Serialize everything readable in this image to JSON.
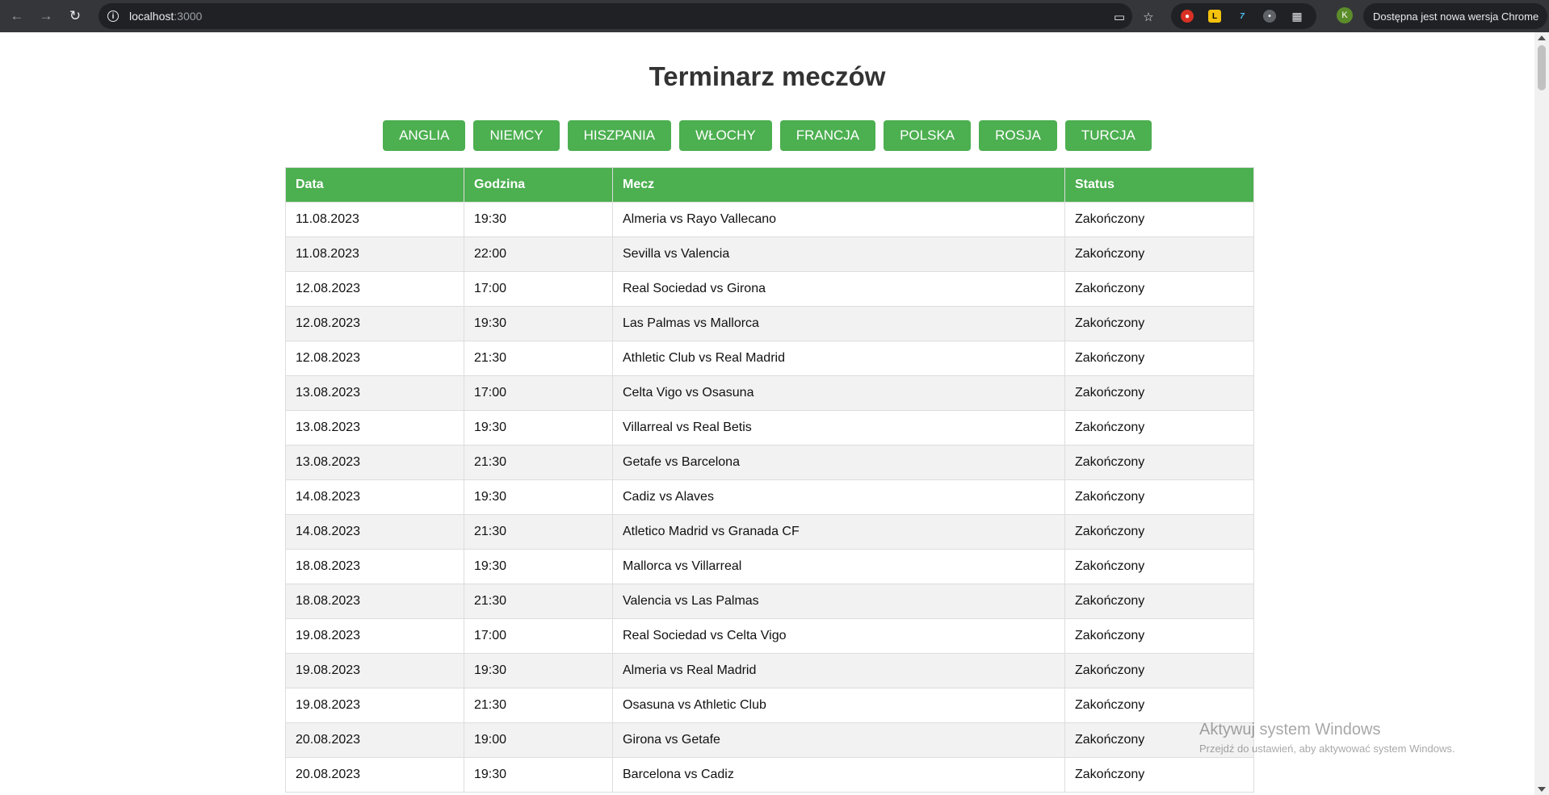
{
  "browser": {
    "url_host": "localhost",
    "url_port": ":3000",
    "profile_initial": "K",
    "update_text": "Dostępna jest nowa wersja Chrome",
    "icons": {
      "back": "arrow-left-icon",
      "forward": "arrow-right-icon",
      "reload": "reload-icon",
      "info": "info-icon",
      "install": "install-app-icon",
      "bookmark": "star-icon",
      "extensions": "puzzle-icon",
      "menu": "kebab-menu-icon"
    }
  },
  "page": {
    "title": "Terminarz meczów",
    "leagues": [
      "ANGLIA",
      "NIEMCY",
      "HISZPANIA",
      "WŁOCHY",
      "FRANCJA",
      "POLSKA",
      "ROSJA",
      "TURCJA"
    ],
    "table": {
      "headers": [
        "Data",
        "Godzina",
        "Mecz",
        "Status"
      ],
      "rows": [
        [
          "11.08.2023",
          "19:30",
          "Almeria vs Rayo Vallecano",
          "Zakończony"
        ],
        [
          "11.08.2023",
          "22:00",
          "Sevilla vs Valencia",
          "Zakończony"
        ],
        [
          "12.08.2023",
          "17:00",
          "Real Sociedad vs Girona",
          "Zakończony"
        ],
        [
          "12.08.2023",
          "19:30",
          "Las Palmas vs Mallorca",
          "Zakończony"
        ],
        [
          "12.08.2023",
          "21:30",
          "Athletic Club vs Real Madrid",
          "Zakończony"
        ],
        [
          "13.08.2023",
          "17:00",
          "Celta Vigo vs Osasuna",
          "Zakończony"
        ],
        [
          "13.08.2023",
          "19:30",
          "Villarreal vs Real Betis",
          "Zakończony"
        ],
        [
          "13.08.2023",
          "21:30",
          "Getafe vs Barcelona",
          "Zakończony"
        ],
        [
          "14.08.2023",
          "19:30",
          "Cadiz vs Alaves",
          "Zakończony"
        ],
        [
          "14.08.2023",
          "21:30",
          "Atletico Madrid vs Granada CF",
          "Zakończony"
        ],
        [
          "18.08.2023",
          "19:30",
          "Mallorca vs Villarreal",
          "Zakończony"
        ],
        [
          "18.08.2023",
          "21:30",
          "Valencia vs Las Palmas",
          "Zakończony"
        ],
        [
          "19.08.2023",
          "17:00",
          "Real Sociedad vs Celta Vigo",
          "Zakończony"
        ],
        [
          "19.08.2023",
          "19:30",
          "Almeria vs Real Madrid",
          "Zakończony"
        ],
        [
          "19.08.2023",
          "21:30",
          "Osasuna vs Athletic Club",
          "Zakończony"
        ],
        [
          "20.08.2023",
          "19:00",
          "Girona vs Getafe",
          "Zakończony"
        ],
        [
          "20.08.2023",
          "19:30",
          "Barcelona vs Cadiz",
          "Zakończony"
        ]
      ]
    }
  },
  "watermark": {
    "title": "Aktywuj system Windows",
    "subtitle": "Przejdź do ustawień, aby aktywować system Windows."
  },
  "colors": {
    "accent": "#4caf50",
    "chrome_bg": "#35363a"
  }
}
